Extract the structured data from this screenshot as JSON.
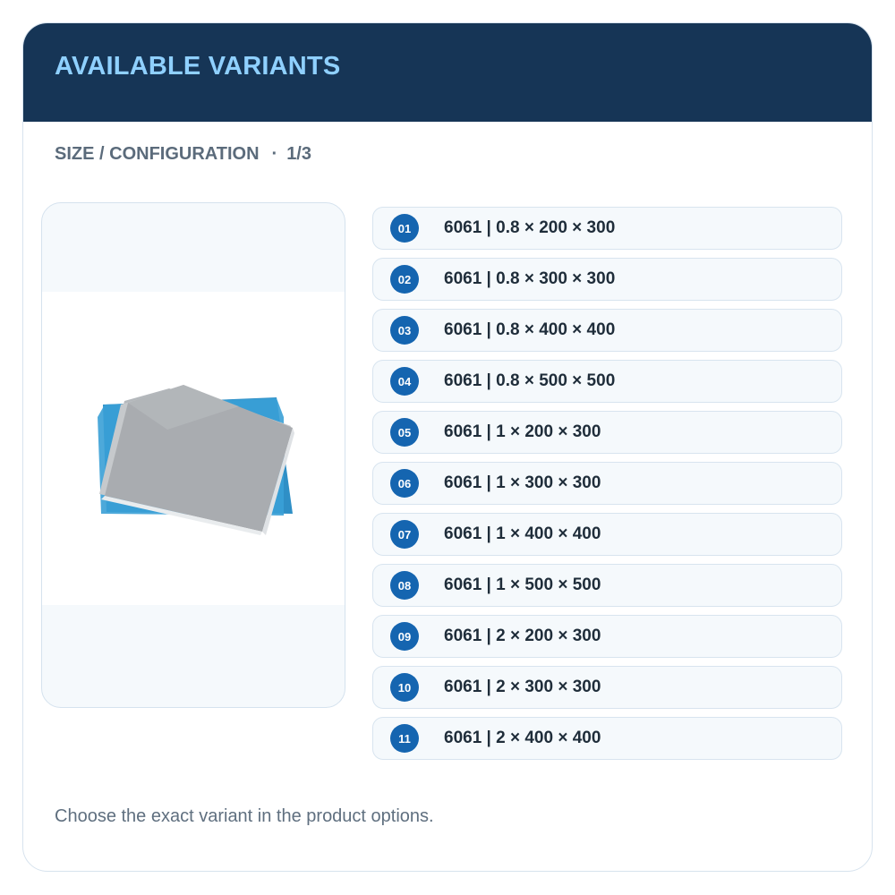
{
  "header": {
    "title": "AVAILABLE VARIANTS"
  },
  "subheader": {
    "label": "SIZE / CONFIGURATION",
    "separator": "·",
    "page": "1/3"
  },
  "product_image": {
    "alt": "Aluminum sheets"
  },
  "variants": [
    {
      "num": "01",
      "label": "6061 | 0.8 × 200 × 300"
    },
    {
      "num": "02",
      "label": "6061 | 0.8 × 300 × 300"
    },
    {
      "num": "03",
      "label": "6061 | 0.8 × 400 × 400"
    },
    {
      "num": "04",
      "label": "6061 | 0.8 × 500 × 500"
    },
    {
      "num": "05",
      "label": "6061 | 1 × 200 × 300"
    },
    {
      "num": "06",
      "label": "6061 | 1 × 300 × 300"
    },
    {
      "num": "07",
      "label": "6061 | 1 × 400 × 400"
    },
    {
      "num": "08",
      "label": "6061 | 1 × 500 × 500"
    },
    {
      "num": "09",
      "label": "6061 | 2 × 200 × 300"
    },
    {
      "num": "10",
      "label": "6061 | 2 × 300 × 300"
    },
    {
      "num": "11",
      "label": "6061 | 2 × 400 × 400"
    }
  ],
  "footer": {
    "text": "Choose the exact variant in the product options."
  },
  "colors": {
    "header_bg": "#163556",
    "title": "#8fd0ff",
    "badge": "#1565b0"
  }
}
